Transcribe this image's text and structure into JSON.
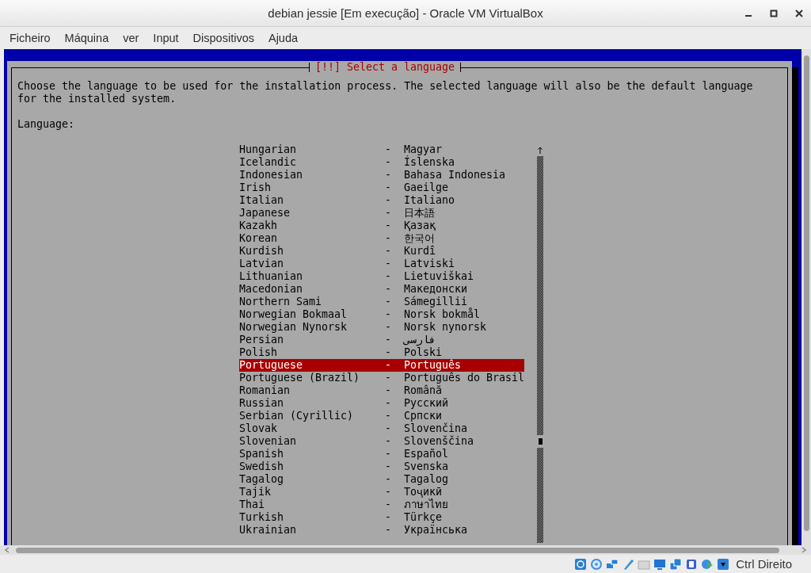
{
  "window": {
    "title": "debian jessie [Em execução] - Oracle VM VirtualBox"
  },
  "menu": [
    "Ficheiro",
    "Máquina",
    "ver",
    "Input",
    "Dispositivos",
    "Ajuda"
  ],
  "dialog": {
    "title": "[!!] Select a language",
    "description": "Choose the language to be used for the installation process. The selected language will also be the default language for the installed system.",
    "list_label": "Language:",
    "languages": [
      {
        "name": "Hungarian",
        "separator": "-",
        "native": "Magyar",
        "selected": false
      },
      {
        "name": "Icelandic",
        "separator": "-",
        "native": "Íslenska",
        "selected": false
      },
      {
        "name": "Indonesian",
        "separator": "-",
        "native": "Bahasa Indonesia",
        "selected": false
      },
      {
        "name": "Irish",
        "separator": "-",
        "native": "Gaeilge",
        "selected": false
      },
      {
        "name": "Italian",
        "separator": "-",
        "native": "Italiano",
        "selected": false
      },
      {
        "name": "Japanese",
        "separator": "-",
        "native": "日本語",
        "selected": false
      },
      {
        "name": "Kazakh",
        "separator": "-",
        "native": "Қазақ",
        "selected": false
      },
      {
        "name": "Korean",
        "separator": "-",
        "native": "한국어",
        "selected": false
      },
      {
        "name": "Kurdish",
        "separator": "-",
        "native": "Kurdî",
        "selected": false
      },
      {
        "name": "Latvian",
        "separator": "-",
        "native": "Latviski",
        "selected": false
      },
      {
        "name": "Lithuanian",
        "separator": "-",
        "native": "Lietuviškai",
        "selected": false
      },
      {
        "name": "Macedonian",
        "separator": "-",
        "native": "Македонски",
        "selected": false
      },
      {
        "name": "Northern Sami",
        "separator": "-",
        "native": "Sámegillii",
        "selected": false
      },
      {
        "name": "Norwegian Bokmaal",
        "separator": "-",
        "native": "Norsk bokmål",
        "selected": false
      },
      {
        "name": "Norwegian Nynorsk",
        "separator": "-",
        "native": "Norsk nynorsk",
        "selected": false
      },
      {
        "name": "Persian",
        "separator": "-",
        "native": "فارسی",
        "selected": false
      },
      {
        "name": "Polish",
        "separator": "-",
        "native": "Polski",
        "selected": false
      },
      {
        "name": "Portuguese",
        "separator": "-",
        "native": "Português",
        "selected": true
      },
      {
        "name": "Portuguese (Brazil)",
        "separator": "-",
        "native": "Português do Brasil",
        "selected": false
      },
      {
        "name": "Romanian",
        "separator": "-",
        "native": "Română",
        "selected": false
      },
      {
        "name": "Russian",
        "separator": "-",
        "native": "Русский",
        "selected": false
      },
      {
        "name": "Serbian (Cyrillic)",
        "separator": "-",
        "native": "Српски",
        "selected": false
      },
      {
        "name": "Slovak",
        "separator": "-",
        "native": "Slovenčina",
        "selected": false
      },
      {
        "name": "Slovenian",
        "separator": "-",
        "native": "Slovenščina",
        "selected": false
      },
      {
        "name": "Spanish",
        "separator": "-",
        "native": "Español",
        "selected": false
      },
      {
        "name": "Swedish",
        "separator": "-",
        "native": "Svenska",
        "selected": false
      },
      {
        "name": "Tagalog",
        "separator": "-",
        "native": "Tagalog",
        "selected": false
      },
      {
        "name": "Tajik",
        "separator": "-",
        "native": "Тоҷикӣ",
        "selected": false
      },
      {
        "name": "Thai",
        "separator": "-",
        "native": "ภาษาไทย",
        "selected": false
      },
      {
        "name": "Turkish",
        "separator": "-",
        "native": "Türkçe",
        "selected": false
      },
      {
        "name": "Ukrainian",
        "separator": "-",
        "native": "Українська",
        "selected": false
      }
    ]
  },
  "status_bar": {
    "host_key": "Ctrl Direito"
  }
}
